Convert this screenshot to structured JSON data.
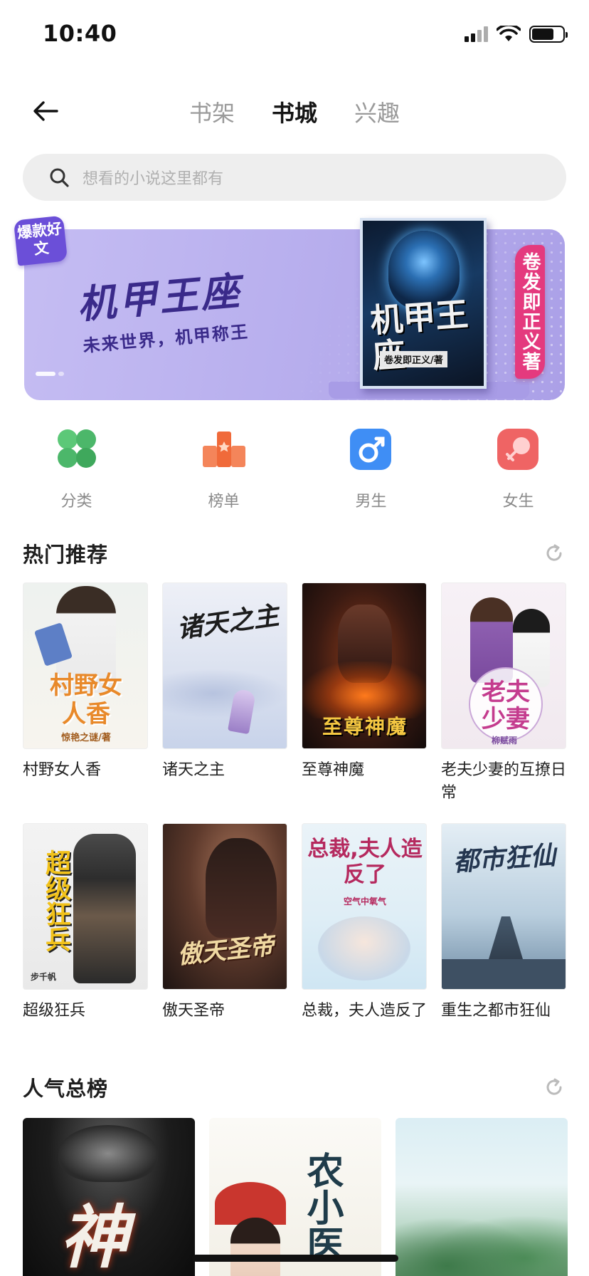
{
  "status_bar": {
    "time": "10:40"
  },
  "nav": {
    "tabs": [
      {
        "label": "书架",
        "active": false
      },
      {
        "label": "书城",
        "active": true
      },
      {
        "label": "兴趣",
        "active": false
      }
    ]
  },
  "search": {
    "placeholder": "想看的小说这里都有",
    "icon": "search-icon"
  },
  "banner": {
    "badge": "爆款好文",
    "title": "机甲王座",
    "subtitle": "未来世界，机甲称王",
    "cover_title": "机甲王座",
    "cover_author": "卷发即正义/著",
    "ribbon": "卷发即正义著"
  },
  "categories": [
    {
      "label": "分类",
      "icon": "grid-clover-icon",
      "color": "#4cb76a"
    },
    {
      "label": "榜单",
      "icon": "podium-icon",
      "color": "#f06a3a"
    },
    {
      "label": "男生",
      "icon": "male-icon",
      "color": "#3f8ef5"
    },
    {
      "label": "女生",
      "icon": "female-icon",
      "color": "#ef5a5a"
    }
  ],
  "hot": {
    "title": "热门推荐",
    "books": [
      {
        "name": "村野女人香",
        "cover_text": "村野女人香",
        "cover_author": "惊艳之谜/著"
      },
      {
        "name": "诸天之主",
        "cover_text": "诸天之主",
        "cover_author": ""
      },
      {
        "name": "至尊神魔",
        "cover_text": "至尊神魔",
        "cover_author": ""
      },
      {
        "name": "老夫少妻的互撩日常",
        "cover_text": "老夫少妻",
        "cover_author": "柳赋雨"
      },
      {
        "name": "超级狂兵",
        "cover_text": "超级狂兵",
        "cover_author": "步千帆"
      },
      {
        "name": "傲天圣帝",
        "cover_text": "傲天圣帝",
        "cover_author": ""
      },
      {
        "name": "总裁，夫人造反了",
        "cover_text": "总裁,夫人造反了",
        "cover_author": "空气中氧气"
      },
      {
        "name": "重生之都市狂仙",
        "cover_text": "都市狂仙",
        "cover_author": ""
      }
    ]
  },
  "popular": {
    "title": "人气总榜",
    "books": [
      {
        "cover_text": "神"
      },
      {
        "cover_text": "农小医"
      },
      {
        "cover_text": ""
      }
    ]
  },
  "colors": {
    "accent_purple": "#6b4fd8",
    "ribbon_pink": "#e43a7e",
    "text_primary": "#1a1a1a",
    "text_secondary": "#8a8a8a"
  }
}
